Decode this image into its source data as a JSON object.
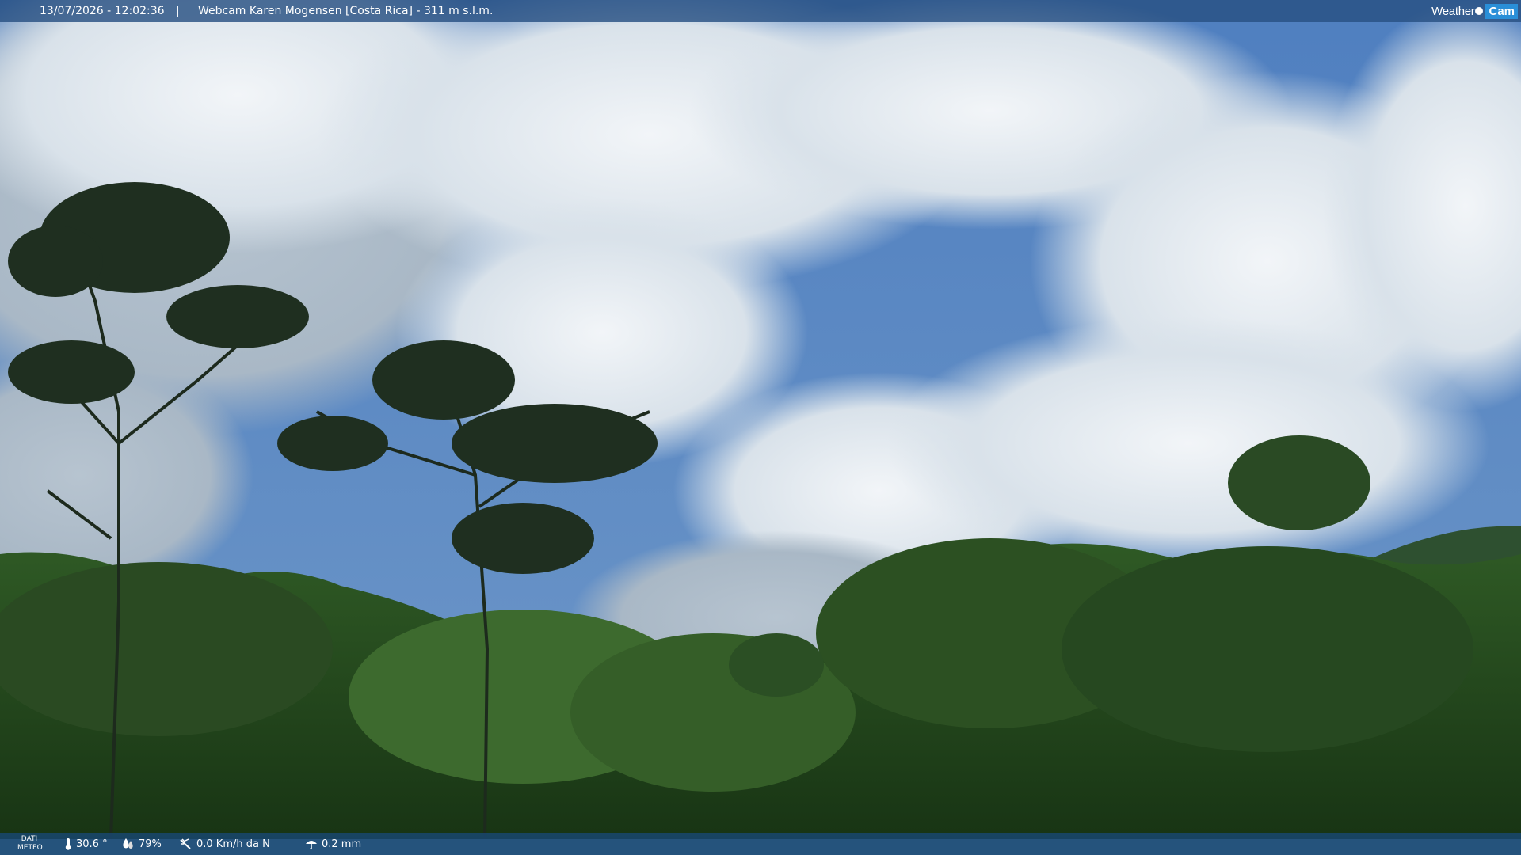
{
  "header": {
    "datetime": "13/07/2026 - 12:02:36",
    "separator": "|",
    "title": "Webcam Karen Mogensen [Costa Rica] - 311 m s.l.m."
  },
  "logo": {
    "part1": "Weather",
    "part2": "Cam"
  },
  "footer": {
    "label_line1": "DATI",
    "label_line2": "METEO",
    "temperature": "30.6 °",
    "humidity": "79%",
    "wind": "0.0 Km/h da N",
    "rain": "0.2 mm"
  },
  "icons": [
    "thermometer-icon",
    "humidity-icon",
    "wind-icon",
    "rain-icon"
  ],
  "colors": {
    "bar": "#285082",
    "sky": "#4a78b8",
    "forest": "#1f3f18"
  }
}
